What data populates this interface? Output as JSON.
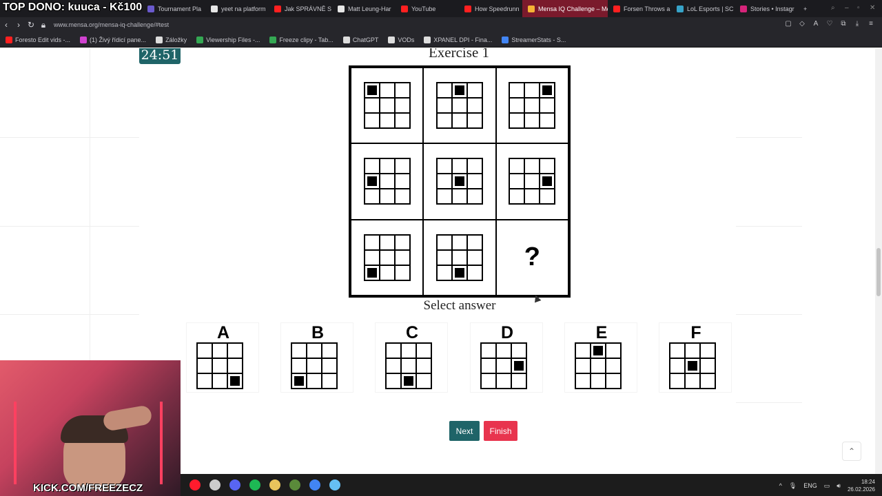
{
  "overlay": {
    "stream_title": "TOP DONO: kuuca - Kč100",
    "kick_url": "KICK.COM/FREEZECZ"
  },
  "tabs": [
    {
      "label": "Tournament Pla",
      "color": "#6a5acd"
    },
    {
      "label": "yeet na platform",
      "color": "#e6e6e6"
    },
    {
      "label": "Jak SPRÁVNĚ S",
      "color": "#ff2020"
    },
    {
      "label": "Matt Leung-Har",
      "color": "#e6e6e6"
    },
    {
      "label": "YouTube",
      "color": "#ff2020"
    },
    {
      "label": "How Speedrunn",
      "color": "#ff2020"
    },
    {
      "label": "Mensa IQ Challenge – Me",
      "color": "#f5b335",
      "active": true
    },
    {
      "label": "Forsen Throws a",
      "color": "#ff2020"
    },
    {
      "label": "LoL Esports | SC",
      "color": "#37a3c8"
    },
    {
      "label": "Stories • Instagr",
      "color": "#d6247a"
    }
  ],
  "address": {
    "url": "www.mensa.org/mensa-iq-challenge/#test"
  },
  "bookmarks": [
    {
      "label": "Foresto Edit vids -...",
      "color": "#ff2020"
    },
    {
      "label": "(1) Živý řídicí pane...",
      "color": "#d042d0"
    },
    {
      "label": "Záložky",
      "color": "#dddddd"
    },
    {
      "label": "Viewership Files -...",
      "color": "#34a853"
    },
    {
      "label": "Freeze clipy - Tab...",
      "color": "#34a853"
    },
    {
      "label": "ChatGPT",
      "color": "#dddddd"
    },
    {
      "label": "VODs",
      "color": "#dddddd"
    },
    {
      "label": "XPANEL DPI - Fina...",
      "color": "#dddddd"
    },
    {
      "label": "StreamerStats - S...",
      "color": "#4285f4"
    }
  ],
  "quiz": {
    "timer": "24:51",
    "exercise_title": "Exercise 1",
    "select_label": "Select answer",
    "question_mark": "?",
    "matrix": [
      {
        "filled": [
          0,
          0
        ]
      },
      {
        "filled": [
          0,
          1
        ]
      },
      {
        "filled": [
          0,
          2
        ]
      },
      {
        "filled": [
          1,
          0
        ]
      },
      {
        "filled": [
          1,
          1
        ]
      },
      {
        "filled": [
          1,
          2
        ]
      },
      {
        "filled": [
          2,
          0
        ]
      },
      {
        "filled": [
          2,
          1
        ]
      },
      {
        "filled": null
      }
    ],
    "options": [
      {
        "letter": "A",
        "filled": [
          2,
          2
        ]
      },
      {
        "letter": "B",
        "filled": [
          2,
          0
        ]
      },
      {
        "letter": "C",
        "filled": [
          2,
          1
        ]
      },
      {
        "letter": "D",
        "filled": [
          1,
          2
        ]
      },
      {
        "letter": "E",
        "filled": [
          0,
          1
        ]
      },
      {
        "letter": "F",
        "filled": [
          1,
          1
        ]
      }
    ],
    "next_label": "Next",
    "finish_label": "Finish"
  },
  "taskbar": {
    "icons": [
      {
        "name": "opera-icon",
        "color": "#ff1b2d"
      },
      {
        "name": "obs-icon",
        "color": "#cccccc"
      },
      {
        "name": "discord-icon",
        "color": "#5865f2"
      },
      {
        "name": "spotify-icon",
        "color": "#1db954"
      },
      {
        "name": "file-icon",
        "color": "#e8c45c"
      },
      {
        "name": "sheet-icon",
        "color": "#5a8a3a"
      },
      {
        "name": "chrome-icon",
        "color": "#4285f4"
      },
      {
        "name": "steam-icon",
        "color": "#66c0f4"
      }
    ],
    "language": "ENG",
    "time": "18:24",
    "date": "26.02.2026"
  }
}
